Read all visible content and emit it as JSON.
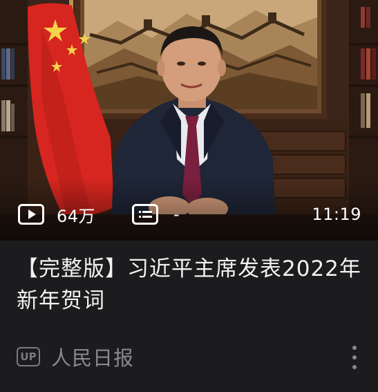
{
  "video": {
    "play_count": "64万",
    "danmaku_count": "-",
    "duration": "11:19",
    "title": "【完整版】习近平主席发表2022年新年贺词",
    "up_badge": "UP",
    "author": "人民日报"
  },
  "icons": {
    "play": "play-count-icon",
    "danmaku": "danmaku-icon",
    "more": "more-vertical-icon"
  },
  "colors": {
    "card_bg": "#1c1c1e",
    "title": "#f2f2f2",
    "meta": "#8a8a8e",
    "flag_red": "#d7261f",
    "flag_star": "#f6d34a"
  }
}
